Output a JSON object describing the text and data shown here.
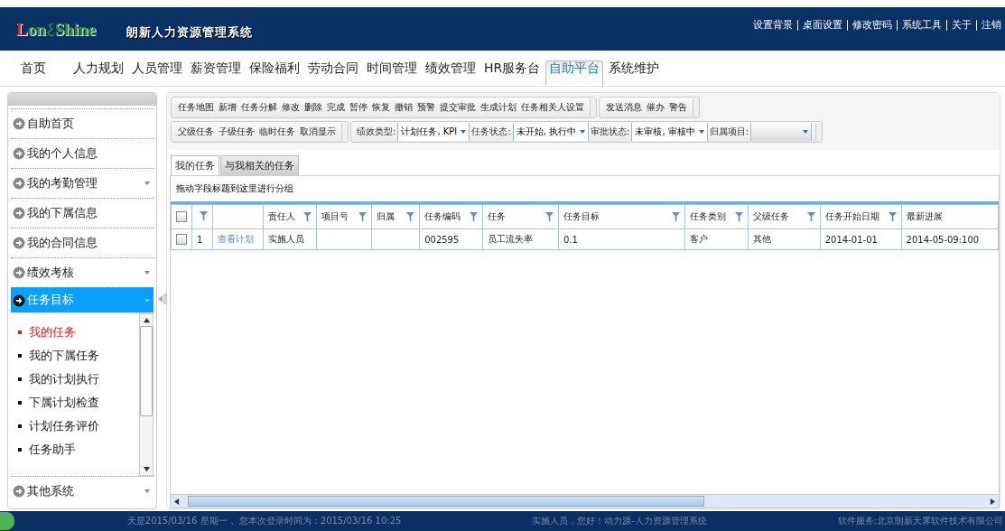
{
  "header": {
    "logo": {
      "left": "Lon",
      "right": "Shine"
    },
    "title": "朗新人力资源管理系统",
    "links": [
      "设置背景",
      "桌面设置",
      "修改密码",
      "系统工具",
      "关于",
      "注销"
    ]
  },
  "menu": [
    {
      "label": "首页",
      "selected": false
    },
    {
      "label": "人力规划",
      "selected": false
    },
    {
      "label": "人员管理",
      "selected": false
    },
    {
      "label": "薪资管理",
      "selected": false
    },
    {
      "label": "保险福利",
      "selected": false
    },
    {
      "label": "劳动合同",
      "selected": false
    },
    {
      "label": "时间管理",
      "selected": false
    },
    {
      "label": "绩效管理",
      "selected": false
    },
    {
      "label": "HR服务台",
      "selected": false
    },
    {
      "label": "自助平台",
      "selected": true
    },
    {
      "label": "系统维护",
      "selected": false
    }
  ],
  "sidebar": {
    "items": [
      {
        "label": "自助首页",
        "expandable": false,
        "selected": false
      },
      {
        "label": "我的个人信息",
        "expandable": false,
        "selected": false
      },
      {
        "label": "我的考勤管理",
        "expandable": true,
        "selected": false
      },
      {
        "label": "我的下属信息",
        "expandable": false,
        "selected": false
      },
      {
        "label": "我的合同信息",
        "expandable": false,
        "selected": false
      },
      {
        "label": "绩效考核",
        "expandable": true,
        "selected": false
      },
      {
        "label": "任务目标",
        "expandable": true,
        "selected": true,
        "children": [
          {
            "label": "我的任务",
            "selected": true
          },
          {
            "label": "我的下属任务",
            "selected": false
          },
          {
            "label": "我的计划执行",
            "selected": false
          },
          {
            "label": "下属计划检查",
            "selected": false
          },
          {
            "label": "计划任务评价",
            "selected": false
          },
          {
            "label": "任务助手",
            "selected": false
          }
        ]
      },
      {
        "label": "其他系统",
        "expandable": true,
        "selected": false
      }
    ]
  },
  "toolbar": {
    "row_1": [
      [
        "任务地图",
        "新增",
        "任务分解",
        "修改",
        "删除",
        "完成",
        "暂停",
        "恢复",
        "撤销",
        "预警",
        "提交审批",
        "生成计划",
        "任务相关人设置"
      ],
      [
        "发送消息",
        "催办",
        "警告"
      ]
    ],
    "row_2": {
      "buttons": [
        "父级任务",
        "子级任务",
        "临时任务",
        "取消显示"
      ],
      "filters": [
        {
          "label": "绩效类型:",
          "value": "计划任务, KPI"
        },
        {
          "label": "任务状态:",
          "value": "未开始, 执行中"
        },
        {
          "label": "审批状态:",
          "value": "未审核, 审核中"
        },
        {
          "label": "归属项目:"
        }
      ]
    }
  },
  "tabs": [
    {
      "label": "我的任务",
      "selected": true
    },
    {
      "label": "与我相关的任务",
      "selected": false
    }
  ],
  "table": {
    "group_hint": "拖动字段标题到这里进行分组",
    "all_checked": false,
    "columns": [
      {
        "label": "责任人",
        "filter": true
      },
      {
        "label": "项目号",
        "filter": true
      },
      {
        "label": "归属",
        "filter": true
      },
      {
        "label": "任务编码",
        "filter": true
      },
      {
        "label": "任务",
        "filter": true
      },
      {
        "label": "任务目标",
        "filter": true
      },
      {
        "label": "任务类别",
        "filter": true
      },
      {
        "label": "父级任务",
        "filter": true
      },
      {
        "label": "任务开始日期",
        "filter": true
      },
      {
        "label": "最新进展",
        "filter": false
      }
    ],
    "rows": [
      {
        "checked": false,
        "number": "1",
        "link": "查看计划",
        "cells": [
          "实施人员",
          "",
          "",
          "002595",
          "员工流失率",
          "0.1",
          "客户",
          "其他",
          "2014-01-01",
          "2014-05-09:100"
        ]
      }
    ]
  },
  "status_bar": {
    "left": "天是2015/03/16 星期一，  您本次登录时间为：2015/03/16 10:25",
    "center": "实施人员，您好！动力源-人力资源管理系统",
    "right": "软件服务:北京朗新天霁软件技术有限公司"
  }
}
